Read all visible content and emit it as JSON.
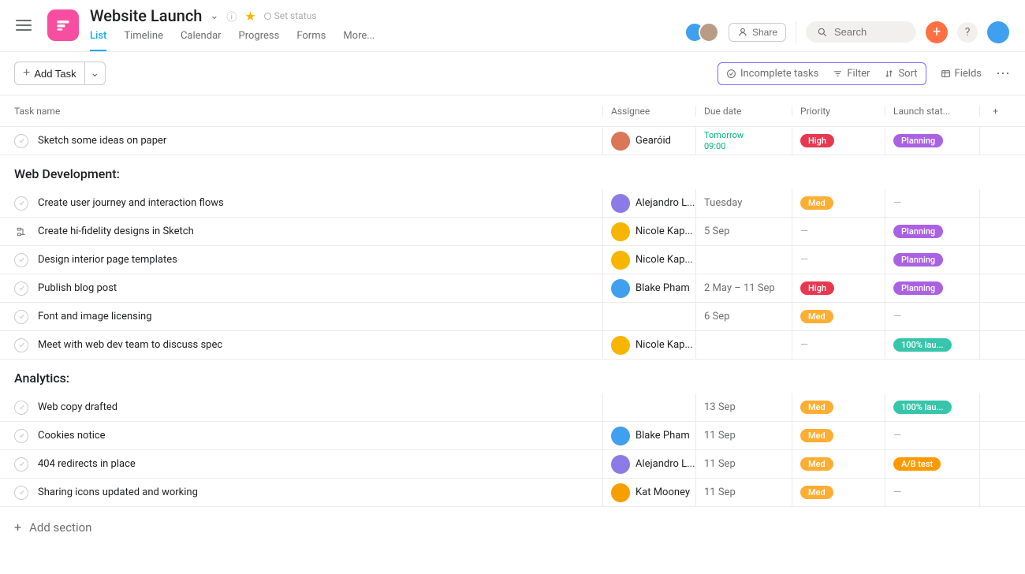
{
  "header": {
    "title": "Website Launch",
    "set_status": "Set status",
    "tabs": [
      "List",
      "Timeline",
      "Calendar",
      "Progress",
      "Forms",
      "More..."
    ],
    "active_tab": 0,
    "share_label": "Share",
    "search_placeholder": "Search"
  },
  "toolbar": {
    "add_task": "Add Task",
    "incomplete": "Incomplete tasks",
    "filter": "Filter",
    "sort": "Sort",
    "fields": "Fields"
  },
  "columns": {
    "task": "Task name",
    "assignee": "Assignee",
    "due": "Due date",
    "priority": "Priority",
    "launch": "Launch stat..."
  },
  "colors": {
    "priority": {
      "High": "#e8384f",
      "Med": "#fdae33"
    },
    "launch": {
      "Planning": "#aa62e3",
      "100% lau...": "#37c5ab",
      "A/B test": "#fd9a00"
    },
    "avatars": {
      "Gearóid": "#d97757",
      "Alejandro L...": "#8c7ae6",
      "Nicole Kap...": "#f7b500",
      "Blake Pham": "#3fa0ef",
      "Kat Mooney": "#f59f00"
    }
  },
  "top_task": {
    "name": "Sketch some ideas on paper",
    "assignee": "Gearóid",
    "due_line1": "Tomorrow",
    "due_line2": "09:00",
    "priority": "High",
    "launch": "Planning"
  },
  "sections": [
    {
      "title": "Web Development:",
      "tasks": [
        {
          "name": "Create user journey and interaction flows",
          "assignee": "Alejandro L...",
          "due": "Tuesday",
          "priority": "Med",
          "launch": "—"
        },
        {
          "name": "Create hi-fidelity designs in Sketch",
          "icon": "subtask",
          "assignee": "Nicole Kap...",
          "due": "5 Sep",
          "priority": "—",
          "launch": "Planning"
        },
        {
          "name": "Design interior page templates",
          "assignee": "Nicole Kap...",
          "due": "",
          "priority": "—",
          "launch": "Planning"
        },
        {
          "name": "Publish blog post",
          "assignee": "Blake Pham",
          "due": "2 May – 11 Sep",
          "priority": "High",
          "launch": "Planning"
        },
        {
          "name": "Font and image licensing",
          "assignee": "",
          "due": "6 Sep",
          "priority": "Med",
          "launch": "—"
        },
        {
          "name": "Meet with web dev team to discuss spec",
          "assignee": "Nicole Kap...",
          "due": "",
          "priority": "—",
          "launch": "100% lau..."
        }
      ]
    },
    {
      "title": "Analytics:",
      "tasks": [
        {
          "name": "Web copy drafted",
          "assignee": "",
          "due": "13 Sep",
          "priority": "Med",
          "launch": "100% lau..."
        },
        {
          "name": "Cookies notice",
          "assignee": "Blake Pham",
          "due": "11 Sep",
          "priority": "Med",
          "launch": "—"
        },
        {
          "name": "404 redirects in place",
          "assignee": "Alejandro L...",
          "due": "11 Sep",
          "priority": "Med",
          "launch": "A/B test"
        },
        {
          "name": "Sharing icons updated and working",
          "assignee": "Kat Mooney",
          "due": "11 Sep",
          "priority": "Med",
          "launch": "—"
        }
      ]
    }
  ],
  "add_section_label": "Add section"
}
